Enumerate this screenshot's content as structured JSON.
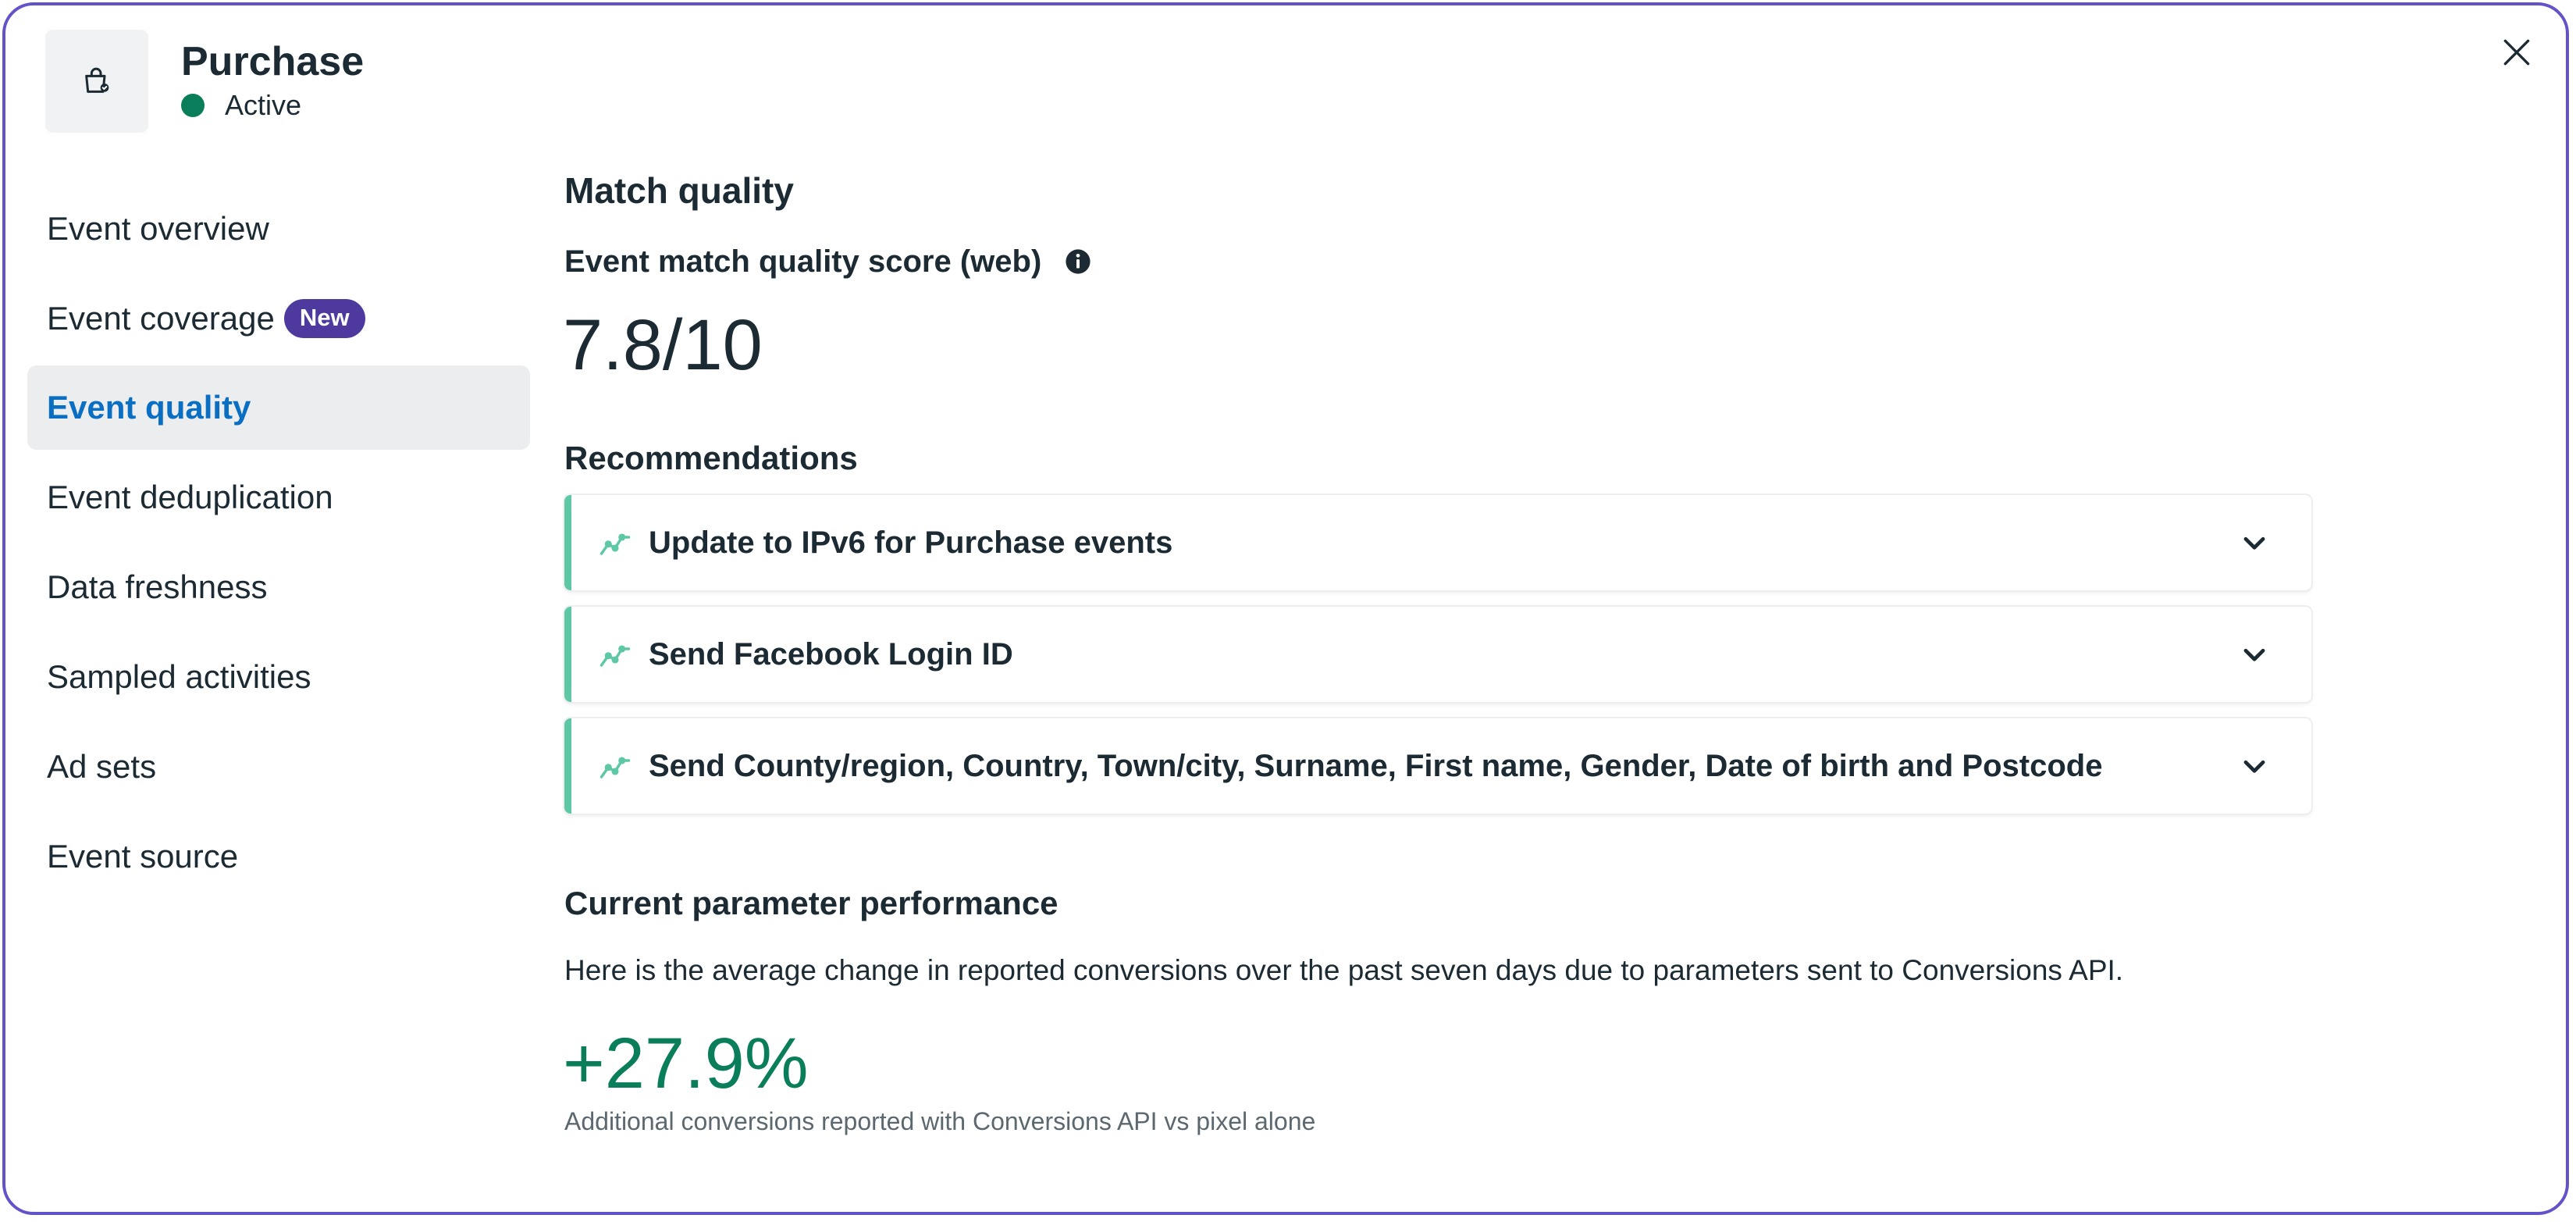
{
  "header": {
    "title": "Purchase",
    "status": "Active",
    "event_icon": "shopping-bag-icon",
    "close_icon": "close-icon"
  },
  "sidebar": {
    "items": [
      {
        "label": "Event overview"
      },
      {
        "label": "Event coverage",
        "badge": "New"
      },
      {
        "label": "Event quality",
        "active": true
      },
      {
        "label": "Event deduplication"
      },
      {
        "label": "Data freshness"
      },
      {
        "label": "Sampled activities"
      },
      {
        "label": "Ad sets"
      },
      {
        "label": "Event source"
      }
    ]
  },
  "main": {
    "title": "Match quality",
    "score_label": "Event match quality score (web)",
    "score_value": "7.8/10",
    "recommendations_title": "Recommendations",
    "recommendations": [
      {
        "label": "Update to IPv6 for Purchase events"
      },
      {
        "label": "Send Facebook Login ID"
      },
      {
        "label": "Send County/region, Country, Town/city, Surname, First name, Gender, Date of birth and Postcode"
      }
    ],
    "performance_title": "Current parameter performance",
    "performance_description": "Here is the average change in reported conversions over the past seven days due to parameters sent to Conversions API.",
    "performance_value": "+27.9%",
    "performance_caption": "Additional conversions reported with Conversions API vs pixel alone"
  },
  "colors": {
    "frame_border": "#6353c9",
    "status_dot": "#0a7e5a",
    "active_nav_text": "#0a6fc2",
    "active_nav_bg": "#ebedef",
    "badge_bg": "#4e3a9e",
    "recommendation_accent": "#5ec7a6",
    "positive_value": "#0a7e5a"
  }
}
